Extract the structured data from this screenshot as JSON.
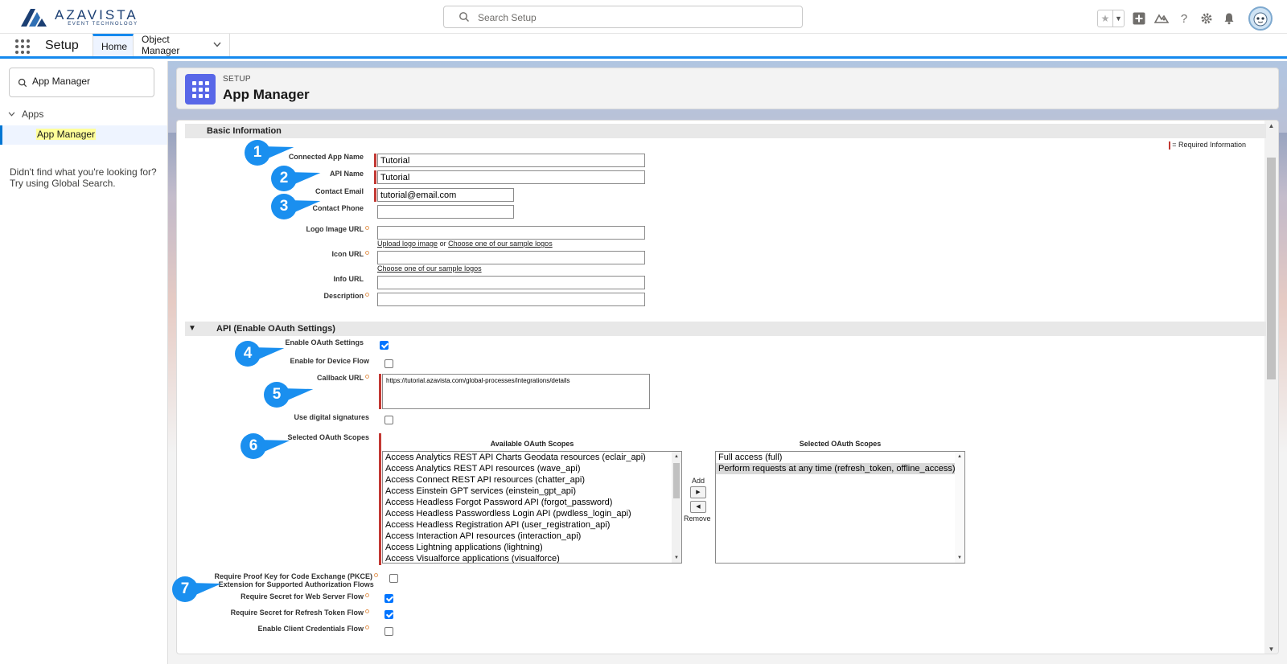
{
  "brand": {
    "name": "AZAVISTA",
    "tagline": "EVENT TECHNOLOGY",
    "color": "#1b3f73"
  },
  "search": {
    "placeholder": "Search Setup"
  },
  "nav": {
    "app_name": "Setup",
    "tabs": [
      {
        "label": "Home",
        "active": true
      },
      {
        "label": "Object Manager",
        "active": false
      }
    ]
  },
  "sidebar": {
    "quick_find_value": "App Manager",
    "tree": {
      "group": "Apps",
      "item": "App Manager"
    },
    "help_line1": "Didn't find what you're looking for?",
    "help_line2": "Try using Global Search."
  },
  "header": {
    "kicker": "SETUP",
    "title": "App Manager",
    "icon_color": "#5867e8"
  },
  "basic": {
    "section_title": "Basic Information",
    "required_legend": "= Required Information",
    "fields": {
      "connected_app_name": {
        "label": "Connected App Name",
        "value": "Tutorial"
      },
      "api_name": {
        "label": "API Name",
        "value": "Tutorial"
      },
      "contact_email": {
        "label": "Contact Email",
        "value": "tutorial@email.com"
      },
      "contact_phone": {
        "label": "Contact Phone",
        "value": ""
      },
      "logo_image_url": {
        "label": "Logo Image URL",
        "value": ""
      },
      "icon_url": {
        "label": "Icon URL",
        "value": ""
      },
      "info_url": {
        "label": "Info URL",
        "value": ""
      },
      "description": {
        "label": "Description",
        "value": ""
      }
    },
    "links": {
      "upload_logo": "Upload logo image",
      "or": "or",
      "sample_logos": "Choose one of our sample logos",
      "sample_logos_icon": "Choose one of our sample logos"
    }
  },
  "api": {
    "section_title": "API (Enable OAuth Settings)",
    "enable_oauth": {
      "label": "Enable OAuth Settings",
      "checked": true
    },
    "device_flow": {
      "label": "Enable for Device Flow",
      "checked": false
    },
    "callback_url": {
      "label": "Callback URL",
      "value": "https://tutorial.azavista.com/global-processes/integrations/details"
    },
    "digital_signatures": {
      "label": "Use digital signatures",
      "checked": false
    },
    "scopes": {
      "label": "Selected OAuth Scopes",
      "available_title": "Available OAuth Scopes",
      "selected_title": "Selected OAuth Scopes",
      "add_label": "Add",
      "remove_label": "Remove",
      "available": [
        "Access Analytics REST API Charts Geodata resources (eclair_api)",
        "Access Analytics REST API resources (wave_api)",
        "Access Connect REST API resources (chatter_api)",
        "Access Einstein GPT services (einstein_gpt_api)",
        "Access Headless Forgot Password API (forgot_password)",
        "Access Headless Passwordless Login API (pwdless_login_api)",
        "Access Headless Registration API (user_registration_api)",
        "Access Interaction API resources (interaction_api)",
        "Access Lightning applications (lightning)",
        "Access Visualforce applications (visualforce)"
      ],
      "selected": [
        "Full access (full)",
        "Perform requests at any time (refresh_token, offline_access)"
      ]
    },
    "pkce": {
      "label_line1": "Require Proof Key for Code Exchange (PKCE)",
      "label_line2": "Extension for Supported Authorization Flows",
      "checked": false
    },
    "secret_web": {
      "label": "Require Secret for Web Server Flow",
      "checked": true
    },
    "secret_refresh": {
      "label": "Require Secret for Refresh Token Flow",
      "checked": true
    },
    "client_credentials": {
      "label": "Enable Client Credentials Flow",
      "checked": false
    }
  },
  "callouts": [
    "1",
    "2",
    "3",
    "4",
    "5",
    "6",
    "7"
  ],
  "colors": {
    "accent": "#1589ee",
    "callout": "#1a8fef",
    "required": "#c23934",
    "checkbox": "#0075ff"
  }
}
